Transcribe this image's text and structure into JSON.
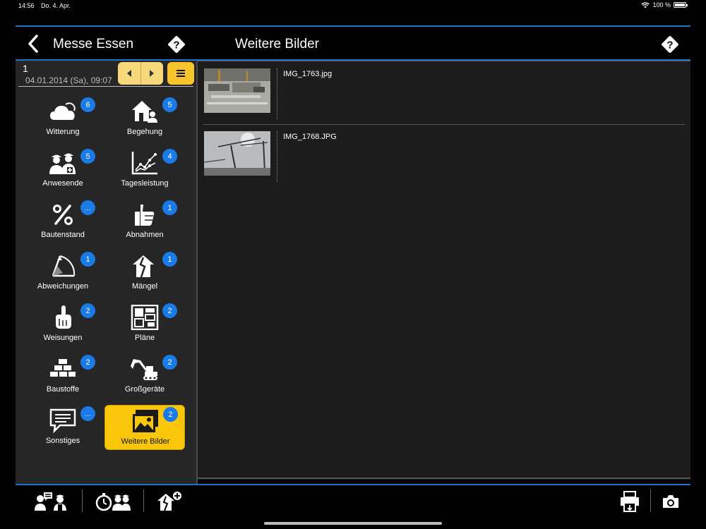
{
  "status_bar": {
    "time": "14:56",
    "date": "Do. 4. Apr.",
    "battery": "100 %"
  },
  "header": {
    "left_title": "Messe Essen",
    "right_title": "Weitere Bilder"
  },
  "day": {
    "number": "1",
    "datetime": "04.01.2014 (Sa), 09:07"
  },
  "categories": [
    {
      "label": "Witterung",
      "badge": "6",
      "icon": "cloud-icon"
    },
    {
      "label": "Begehung",
      "badge": "5",
      "icon": "house-person-icon"
    },
    {
      "label": "Anwesende",
      "badge": "5",
      "icon": "workers-icon"
    },
    {
      "label": "Tagesleistung",
      "badge": "4",
      "icon": "line-chart-icon"
    },
    {
      "label": "Bautenstand",
      "badge": "...",
      "icon": "percent-icon"
    },
    {
      "label": "Abnahmen",
      "badge": "1",
      "icon": "thumbs-up-icon"
    },
    {
      "label": "Abweichungen",
      "badge": "1",
      "icon": "deviation-icon"
    },
    {
      "label": "Mängel",
      "badge": "1",
      "icon": "broken-house-icon"
    },
    {
      "label": "Weisungen",
      "badge": "2",
      "icon": "raised-finger-icon"
    },
    {
      "label": "Pläne",
      "badge": "2",
      "icon": "floorplan-icon"
    },
    {
      "label": "Baustoffe",
      "badge": "2",
      "icon": "bricks-icon"
    },
    {
      "label": "Großgeräte",
      "badge": "2",
      "icon": "excavator-icon"
    },
    {
      "label": "Sonstiges",
      "badge": "...",
      "icon": "speech-bubble-icon"
    },
    {
      "label": "Weitere Bilder",
      "badge": "2",
      "icon": "pictures-icon",
      "active": true
    }
  ],
  "images": [
    {
      "name": "IMG_1763.jpg"
    },
    {
      "name": "IMG_1768.JPG"
    }
  ],
  "colors": {
    "accent": "#1e73c8",
    "badge": "#1a7ae8",
    "active_tile": "#f9c60a",
    "nav_button": "#f7d87a"
  }
}
